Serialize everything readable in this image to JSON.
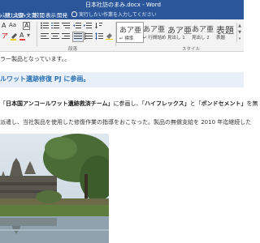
{
  "window": {
    "title": "日本社訪のまみ.docx - Word"
  },
  "tabs": [
    "込み込む文書",
    "差し込み文書",
    "校閲",
    "表示",
    "開発"
  ],
  "tell_me": {
    "placeholder": "実行したい作業を入力してください"
  },
  "ribbon": {
    "font_group": {
      "buttons": [
        "A",
        "Aa",
        "A",
        "ア",
        "A"
      ],
      "font_color": "#e04040",
      "highlight_color": "#f0d000"
    },
    "paragraph_group": {
      "label": "段落"
    },
    "styles_group": {
      "label": "スタイル",
      "styles": [
        {
          "sample": "あア亜",
          "name": "↵ 標準",
          "selected": true
        },
        {
          "sample": "あア亜",
          "name": "↵ 行間詰め",
          "selected": false
        },
        {
          "sample": "あア亜",
          "name": "見出し 1",
          "selected": false
        },
        {
          "sample": "あア亜",
          "name": "見出し 2",
          "selected": false
        },
        {
          "sample": "表題",
          "name": "表題",
          "selected": false
        }
      ]
    }
  },
  "document": {
    "line1": "ラー製品となっています。。",
    "heading": "ルワット遺跡修復 PJ に参画。",
    "para1": {
      "prefix": "「",
      "bold1": "日本国アンコールワット遺跡救済チーム」",
      "mid1": "に参画し、「",
      "bold2": "ハイフレックス」",
      "mid2": "と「",
      "bold3": "ボンドセメント」",
      "tail": "を無"
    },
    "para2": "派遣し、当社製品を使用した修復作業の指導をおこなった。製品の無償支給を 2010 年迄継続した"
  }
}
